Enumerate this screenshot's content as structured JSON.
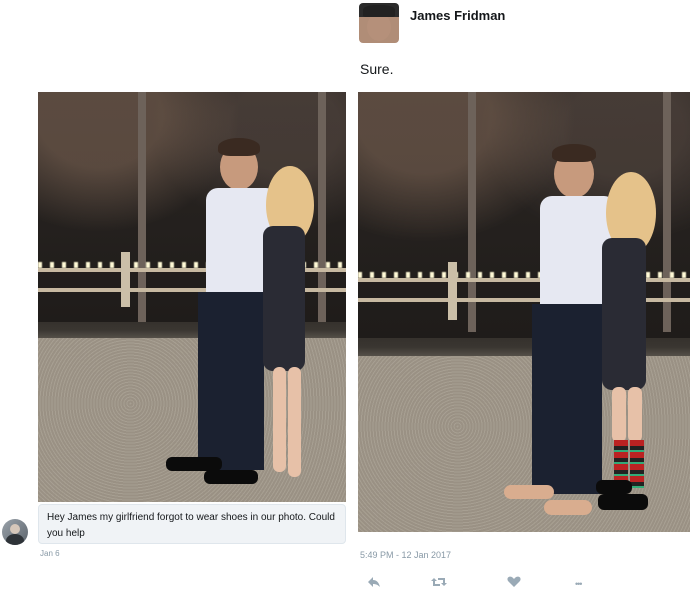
{
  "tweet": {
    "author_name": "James Fridman",
    "reply_text": "Sure.",
    "timestamp": "5:49 PM - 12 Jan 2017"
  },
  "request": {
    "message_text": "Hey James my girlfriend forgot to wear shoes in our photo. Could you help",
    "date": "Jan 6"
  },
  "actions": {
    "reply_icon": "reply-icon",
    "retweet_icon": "retweet-icon",
    "like_icon": "heart-icon",
    "more_icon": "more-icon",
    "more_glyph": "•••"
  },
  "colors": {
    "meta_text": "#8899a6",
    "bubble_bg": "#f0f3f6"
  }
}
